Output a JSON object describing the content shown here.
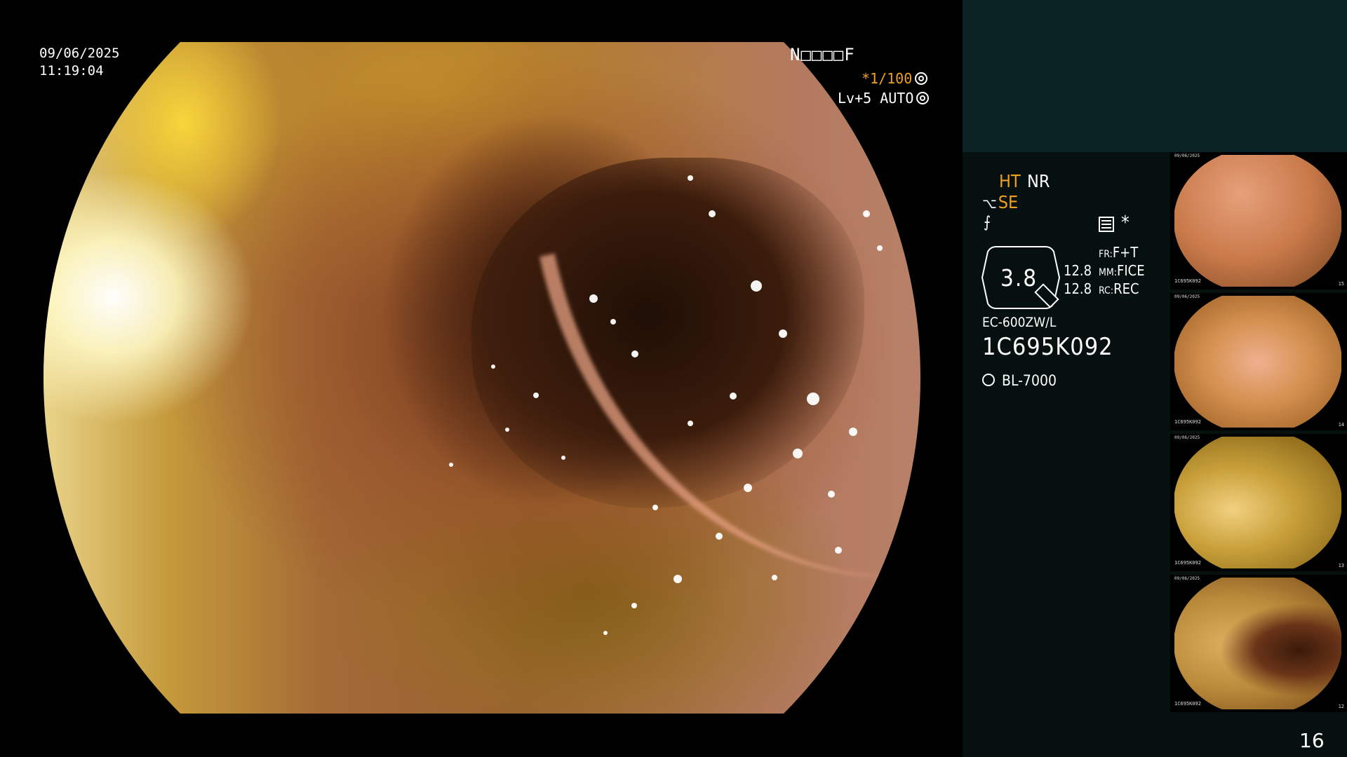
{
  "overlay": {
    "date": "09/06/2025",
    "time": "11:19:04",
    "patient_id": "N□□□□F",
    "shutter": "*1/100",
    "level": "Lv+5 AUTO"
  },
  "settings": {
    "ht": "HT",
    "nr": "NR",
    "se": "SE",
    "asterisk": "*",
    "zoom": "3.8",
    "value1": "12.8",
    "value2": "12.8",
    "fr_label": "FR:",
    "fr_value": "F+T",
    "mm_label": "MM:",
    "mm_value": "FICE",
    "rc_label": "RC:",
    "rc_value": "REC"
  },
  "scope": {
    "model": "EC-600ZW/L",
    "serial": "1C695K092",
    "light_source": "BL-7000"
  },
  "thumbnails": [
    {
      "date": "09/06/2025",
      "id": "1C695K092",
      "num": "15"
    },
    {
      "date": "09/06/2025",
      "id": "1C695K092",
      "num": "14"
    },
    {
      "date": "09/06/2025",
      "id": "1C695K092",
      "num": "13"
    },
    {
      "date": "09/06/2025",
      "id": "1C695K092",
      "num": "12"
    }
  ],
  "page_number": "16",
  "colors": {
    "accent_orange": "#f0a020",
    "panel_bg": "#06100f",
    "panel_top_bg": "#0c2325"
  }
}
